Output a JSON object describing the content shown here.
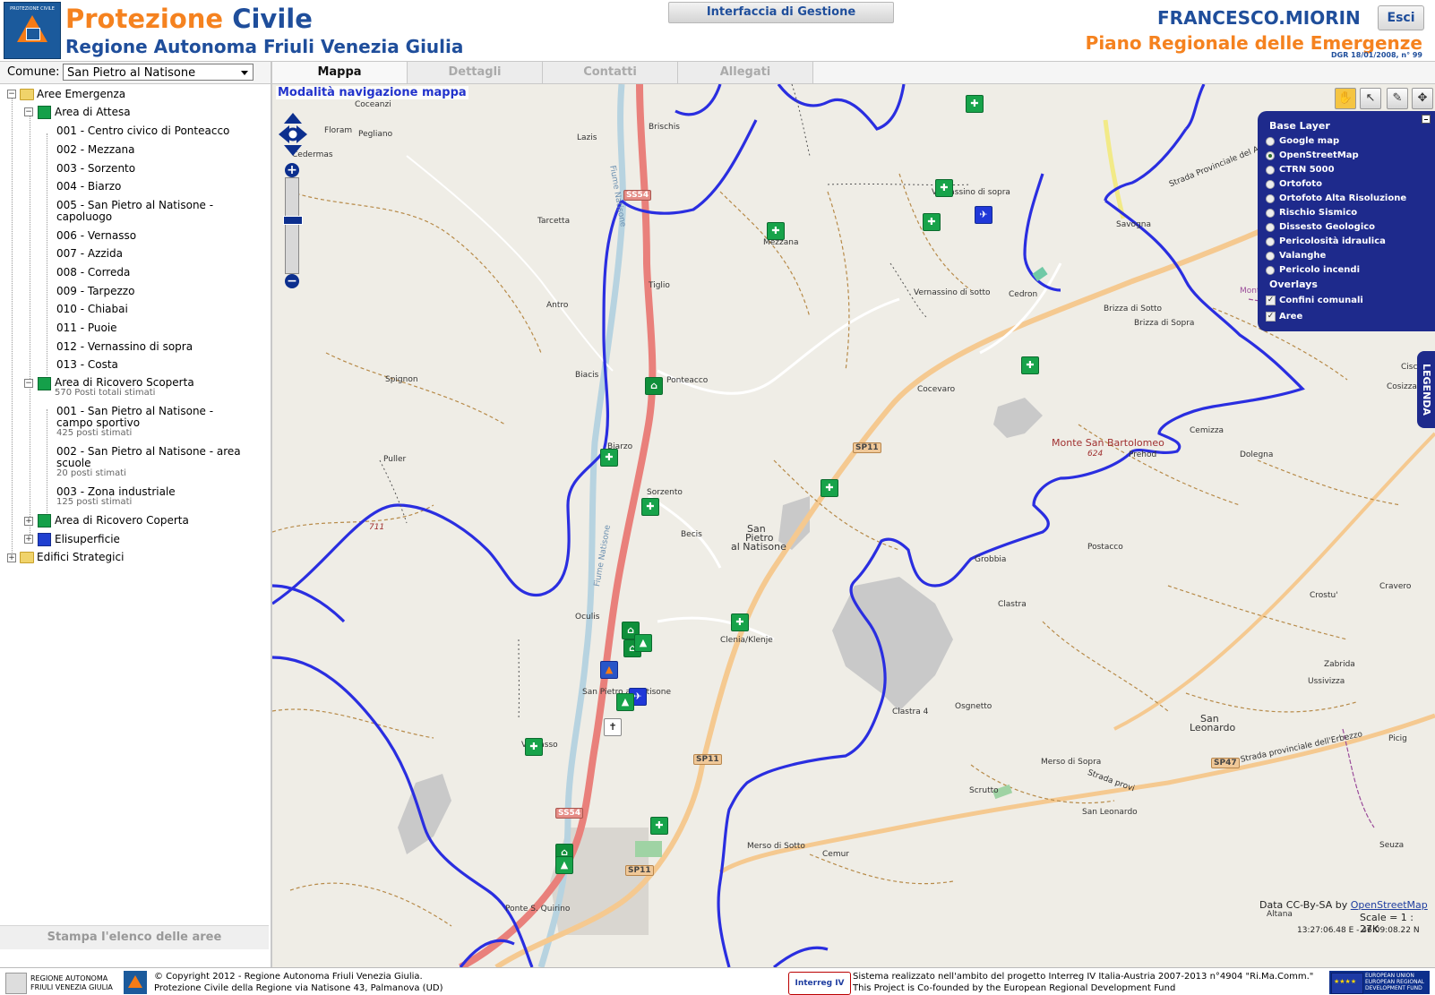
{
  "header": {
    "logo_alt": "Protezione Civile",
    "title_a": "Protezione",
    "title_b": "Civile",
    "subtitle": "Regione Autonoma Friuli Venezia Giulia",
    "admin_button": "Interfaccia di Gestione",
    "user": "FRANCESCO.MIORIN",
    "logout": "Esci",
    "plan_title": "Piano Regionale delle Emergenze",
    "dgr": "DGR 18/01/2008, n° 99"
  },
  "sidebar": {
    "comune_label": "Comune:",
    "comune_value": "San Pietro al Natisone",
    "root": "Aree Emergenza",
    "attesa": {
      "label": "Area di Attesa",
      "items": [
        "001 - Centro civico di Ponteacco",
        "002 - Mezzana",
        "003 - Sorzento",
        "004 - Biarzo",
        "005 - San Pietro al Natisone -",
        "capoluogo",
        "006 - Vernasso",
        "007 - Azzida",
        "008 - Correda",
        "009 - Tarpezzo",
        "010 - Chiabai",
        "011 - Puoie",
        "012 - Vernassino di sopra",
        "013 - Costa"
      ]
    },
    "scoperta": {
      "label": "Area di Ricovero Scoperta",
      "note": "570 Posti totali stimati",
      "items": [
        {
          "l1": "001 - San Pietro al Natisone -",
          "l2": "campo sportivo",
          "note": "425 posti stimati"
        },
        {
          "l1": "002 - San Pietro al Natisone - area",
          "l2": "scuole",
          "note": "20 posti stimati"
        },
        {
          "l1": "003 - Zona industriale",
          "l2": "",
          "note": "125 posti stimati"
        }
      ]
    },
    "coperta": "Area di Ricovero Coperta",
    "elisuperficie": "Elisuperficie",
    "edifici": "Edifici Strategici",
    "print": "Stampa l'elenco delle aree"
  },
  "tabs": [
    "Mappa",
    "Dettagli",
    "Contatti",
    "Allegati"
  ],
  "map": {
    "nav_mode": "Modalità navigazione mappa",
    "places": {
      "coceanzi": "Coceanzi",
      "floram": "Floram",
      "pegliano": "Pegliano",
      "cedermas": "Cedermas",
      "lazis": "Lazis",
      "brischis": "Brischis",
      "tarcetta": "Tarcetta",
      "tiglio": "Tiglio",
      "antro": "Antro",
      "mezzana": "Mezzana",
      "vernassino_sopra": "Vernassino di sopra",
      "vernassino_sotto": "Vernassino di sotto",
      "cedron": "Cedron",
      "savogna": "Savogna",
      "brizza_sotto": "Brizza di Sotto",
      "brizza_sopra": "Brizza di Sopra",
      "monte_s": "Monte S",
      "spignon": "Spignon",
      "biacis": "Biacis",
      "ponteacco": "Ponteacco",
      "cocevaro": "Cocevaro",
      "monte_bartolomeo": "Monte San Bartolomeo",
      "quota624": "624",
      "prehod": "Prehod",
      "cemizza": "Cemizza",
      "dolegna": "Dolegna",
      "cosizza": "Cosizza",
      "cisca": "Ciscaa",
      "puller": "Puller",
      "quota711": "711",
      "biarzo": "Biarzo",
      "sorzento": "Sorzento",
      "becis": "Becis",
      "san_pietro_1": "San",
      "san_pietro_2": "Pietro",
      "san_pietro_3": "al Natisone",
      "grobbia": "Grobbia",
      "postacco": "Postacco",
      "crostu": "Crostu'",
      "cravero": "Cravero",
      "clastra": "Clastra",
      "clastra4": "Clastra 4",
      "oculis": "Oculis",
      "clenia": "Clenia/Klenje",
      "zabrida": "Zabrida",
      "ussivizza": "Ussivizza",
      "osgnetto": "Osgnetto",
      "san_leonardo_1": "San",
      "san_leonardo_2": "Leonardo",
      "sp_natisone": "San Pietro al Natisone",
      "vernasso": "Vernasso",
      "picig": "Picig",
      "merso_sopra": "Merso di Sopra",
      "scrutto": "Scrutto",
      "san_leonardo_small": "San Leonardo",
      "merso_sotto": "Merso di Sotto",
      "cemur": "Cemur",
      "seuza": "Seuza",
      "altana": "Altana",
      "ponte_quirino": "Ponte S. Quirino",
      "fiume": "Fiume Natisone",
      "fiume2": "Fiume Natisone",
      "sp_savogna": "Strada Provinciale del Alberone",
      "sp_erbezzo": "Strada provinciale dell'Erbezzo",
      "strada_prov": "Strada provi"
    },
    "roads": {
      "ss54a": "SS54",
      "ss54b": "SS54",
      "sp11a": "SP11",
      "sp11b": "SP11",
      "sp11c": "SP11",
      "sp47": "SP47"
    },
    "layers": {
      "base_title": "Base Layer",
      "base": [
        "Google map",
        "OpenStreetMap",
        "CTRN 5000",
        "Ortofoto",
        "Ortofoto Alta Risoluzione",
        "Rischio Sismico",
        "Dissesto Geologico",
        "Pericolosità idraulica",
        "Valanghe",
        "Pericolo incendi"
      ],
      "selected": "OpenStreetMap",
      "overlays_title": "Overlays",
      "overlays": [
        "Confini comunali",
        "Aree"
      ]
    },
    "legend": "LEGENDA",
    "attribution_prefix": "Data CC-By-SA by",
    "attribution_link": "OpenStreetMap",
    "scale": "Scale = 1 : 27K",
    "coords": "13:27:06.48 E - 46:09:08.22 N"
  },
  "footer": {
    "region_line1": "REGIONE AUTONOMA",
    "region_line2": "FRIULI VENEZIA GIULIA",
    "copyright1": "© Copyright 2012 - Regione Autonoma Friuli Venezia Giulia.",
    "copyright2": "Protezione Civile della Regione via Natisone 43, Palmanova (UD)",
    "interreg": "Interreg IV",
    "project1": "Sistema realizzato nell'ambito del progetto Interreg IV Italia-Austria 2007-2013 n°4904 \"Ri.Ma.Comm.\"",
    "project2": "This Project is Co-founded by the European Regional Development Fund",
    "eu_line1": "EUROPEAN UNION",
    "eu_line2": "EUROPEAN REGIONAL",
    "eu_line3": "DEVELOPMENT FUND"
  },
  "colors": {
    "orange": "#f5821f",
    "blue": "#1f4e9b",
    "boundary": "#2a2ee0",
    "green_marker": "#17a34a"
  }
}
